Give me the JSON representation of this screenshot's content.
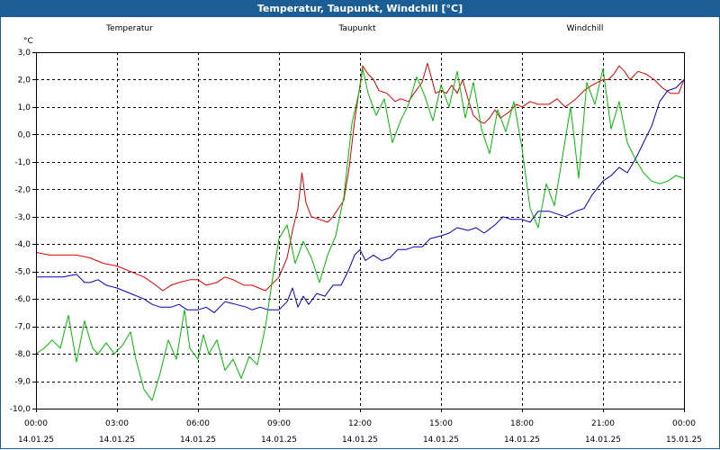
{
  "window": {
    "title": "Temperatur, Taupunkt, Windchill [°C]"
  },
  "colors": {
    "temperature": "#dd0000",
    "dewpoint": "#0000bb",
    "windchill": "#00bb00",
    "titlebar": "#1b5e95",
    "grid": "#000000"
  },
  "chart_data": {
    "type": "line",
    "title": "Temperatur, Taupunkt, Windchill [°C]",
    "ylabel": "°C",
    "xlabel": "",
    "grid": true,
    "legend": "top",
    "ylim": [
      -10.0,
      3.0
    ],
    "xlim_hours": [
      0,
      24
    ],
    "yticks": [
      "3,0",
      "2,0",
      "1,0",
      "0,0",
      "-1,0",
      "-2,0",
      "-3,0",
      "-4,0",
      "-5,0",
      "-6,0",
      "-7,0",
      "-8,0",
      "-9,0",
      "-10,0"
    ],
    "ytick_values": [
      3,
      2,
      1,
      0,
      -1,
      -2,
      -3,
      -4,
      -5,
      -6,
      -7,
      -8,
      -9,
      -10
    ],
    "xtick_values": [
      0,
      3,
      6,
      9,
      12,
      15,
      18,
      21,
      24
    ],
    "xticks_time": [
      "00:00",
      "03:00",
      "06:00",
      "09:00",
      "12:00",
      "15:00",
      "18:00",
      "21:00",
      "00:00"
    ],
    "xticks_date": [
      "14.01.25",
      "14.01.25",
      "14.01.25",
      "14.01.25",
      "14.01.25",
      "14.01.25",
      "14.01.25",
      "14.01.25",
      "15.01.25"
    ],
    "series": [
      {
        "name": "Temperatur",
        "x": [
          0,
          0.5,
          1,
          1.5,
          2,
          2.5,
          3,
          3.5,
          4,
          4.3,
          4.7,
          5,
          5.3,
          5.7,
          6,
          6.3,
          6.7,
          7,
          7.3,
          7.7,
          8,
          8.5,
          8.8,
          9,
          9.3,
          9.5,
          9.7,
          9.85,
          10,
          10.2,
          10.5,
          10.8,
          11,
          11.2,
          11.4,
          11.6,
          11.8,
          12,
          12.1,
          12.3,
          12.5,
          12.7,
          13,
          13.3,
          13.5,
          13.8,
          14,
          14.3,
          14.5,
          14.8,
          15,
          15.2,
          15.4,
          15.6,
          15.8,
          16,
          16.2,
          16.4,
          16.6,
          16.8,
          17,
          17.2,
          17.5,
          17.8,
          18,
          18.3,
          18.6,
          19,
          19.3,
          19.6,
          20,
          20.3,
          20.6,
          21,
          21.2,
          21.4,
          21.6,
          21.8,
          22,
          22.3,
          22.6,
          22.9,
          23.2,
          23.5,
          23.8,
          24
        ],
        "values": [
          -4.3,
          -4.4,
          -4.4,
          -4.4,
          -4.5,
          -4.7,
          -4.8,
          -5.0,
          -5.2,
          -5.4,
          -5.7,
          -5.5,
          -5.4,
          -5.3,
          -5.3,
          -5.5,
          -5.4,
          -5.2,
          -5.3,
          -5.5,
          -5.5,
          -5.7,
          -5.4,
          -5.2,
          -4.5,
          -3.5,
          -2.7,
          -1.4,
          -2.5,
          -3.0,
          -3.1,
          -3.2,
          -3.0,
          -2.7,
          -2.4,
          -1.2,
          0.5,
          1.8,
          2.5,
          2.2,
          2.0,
          1.6,
          1.5,
          1.2,
          1.3,
          1.2,
          1.5,
          1.9,
          2.6,
          1.5,
          1.6,
          1.5,
          1.8,
          1.5,
          2.0,
          1.3,
          0.7,
          0.5,
          0.4,
          0.6,
          0.9,
          0.6,
          0.8,
          1.1,
          1.0,
          1.2,
          1.1,
          1.1,
          1.3,
          1.0,
          1.3,
          1.6,
          1.8,
          2.0,
          2.0,
          2.2,
          2.5,
          2.3,
          2.0,
          2.3,
          2.2,
          2.0,
          1.7,
          1.5,
          1.5,
          2.0
        ]
      },
      {
        "name": "Taupunkt",
        "x": [
          0,
          0.5,
          1,
          1.5,
          1.8,
          2,
          2.3,
          2.6,
          3,
          3.5,
          4,
          4.3,
          4.6,
          5,
          5.3,
          5.6,
          6,
          6.3,
          6.6,
          7,
          7.4,
          7.8,
          8,
          8.3,
          8.6,
          9,
          9.3,
          9.5,
          9.7,
          9.9,
          10.1,
          10.4,
          10.7,
          11,
          11.3,
          11.6,
          11.8,
          12,
          12.2,
          12.5,
          12.8,
          13.1,
          13.4,
          13.7,
          14,
          14.3,
          14.6,
          15,
          15.3,
          15.6,
          16,
          16.3,
          16.6,
          17,
          17.3,
          17.6,
          18,
          18.3,
          18.6,
          19,
          19.3,
          19.6,
          20,
          20.3,
          20.6,
          21,
          21.3,
          21.6,
          21.9,
          22.2,
          22.5,
          22.8,
          23.1,
          23.4,
          23.7,
          24
        ],
        "values": [
          -5.2,
          -5.2,
          -5.2,
          -5.1,
          -5.4,
          -5.4,
          -5.3,
          -5.5,
          -5.6,
          -5.8,
          -6.0,
          -6.2,
          -6.3,
          -6.3,
          -6.2,
          -6.4,
          -6.4,
          -6.3,
          -6.5,
          -6.1,
          -6.2,
          -6.3,
          -6.4,
          -6.3,
          -6.4,
          -6.4,
          -6.1,
          -5.6,
          -6.3,
          -5.9,
          -6.2,
          -5.8,
          -5.9,
          -5.5,
          -5.5,
          -4.9,
          -4.4,
          -4.2,
          -4.6,
          -4.4,
          -4.6,
          -4.5,
          -4.2,
          -4.2,
          -4.1,
          -4.1,
          -3.8,
          -3.7,
          -3.6,
          -3.4,
          -3.5,
          -3.4,
          -3.6,
          -3.3,
          -3.0,
          -3.1,
          -3.1,
          -3.2,
          -2.8,
          -2.8,
          -2.9,
          -3.0,
          -2.8,
          -2.7,
          -2.2,
          -1.7,
          -1.5,
          -1.2,
          -1.4,
          -0.9,
          -0.3,
          0.3,
          1.2,
          1.6,
          1.7,
          2.0
        ]
      },
      {
        "name": "Windchill",
        "x": [
          0,
          0.3,
          0.6,
          0.9,
          1.2,
          1.5,
          1.8,
          2.0,
          2.1,
          2.3,
          2.6,
          2.9,
          3.2,
          3.5,
          3.7,
          4.0,
          4.3,
          4.6,
          4.9,
          5.2,
          5.5,
          5.7,
          6.0,
          6.2,
          6.4,
          6.7,
          7.0,
          7.3,
          7.6,
          7.9,
          8.2,
          8.5,
          8.8,
          9.0,
          9.3,
          9.6,
          9.9,
          10.2,
          10.5,
          10.8,
          11.1,
          11.4,
          11.7,
          12.0,
          12.1,
          12.3,
          12.6,
          12.9,
          13.2,
          13.5,
          13.8,
          14.1,
          14.4,
          14.7,
          15.0,
          15.3,
          15.6,
          15.9,
          16.2,
          16.5,
          16.8,
          17.1,
          17.4,
          17.7,
          18.0,
          18.3,
          18.6,
          18.9,
          19.2,
          19.5,
          19.8,
          20.1,
          20.4,
          20.7,
          21.0,
          21.3,
          21.6,
          21.9,
          22.2,
          22.5,
          22.8,
          23.1,
          23.4,
          23.7,
          24.0
        ],
        "values": [
          -8.0,
          -7.8,
          -7.5,
          -7.8,
          -6.6,
          -8.3,
          -6.8,
          -7.5,
          -7.8,
          -8.0,
          -7.6,
          -8.0,
          -7.7,
          -7.2,
          -8.2,
          -9.3,
          -9.7,
          -8.7,
          -7.5,
          -8.2,
          -6.4,
          -7.8,
          -8.2,
          -7.3,
          -8.0,
          -7.5,
          -8.6,
          -8.2,
          -8.9,
          -8.1,
          -8.4,
          -7.0,
          -5.0,
          -3.8,
          -3.3,
          -4.7,
          -3.9,
          -4.5,
          -5.4,
          -4.4,
          -3.7,
          -2.3,
          0.4,
          1.7,
          2.4,
          1.5,
          0.7,
          1.3,
          -0.3,
          0.5,
          1.1,
          2.1,
          1.4,
          0.5,
          1.8,
          1.0,
          2.3,
          0.6,
          1.9,
          0.2,
          -0.7,
          0.9,
          0.1,
          1.2,
          -0.5,
          -2.7,
          -3.4,
          -1.8,
          -2.6,
          -0.8,
          1.0,
          -1.6,
          1.9,
          1.1,
          2.4,
          0.2,
          1.2,
          -0.3,
          -0.9,
          -1.4,
          -1.7,
          -1.8,
          -1.7,
          -1.5,
          -1.6
        ]
      }
    ]
  }
}
